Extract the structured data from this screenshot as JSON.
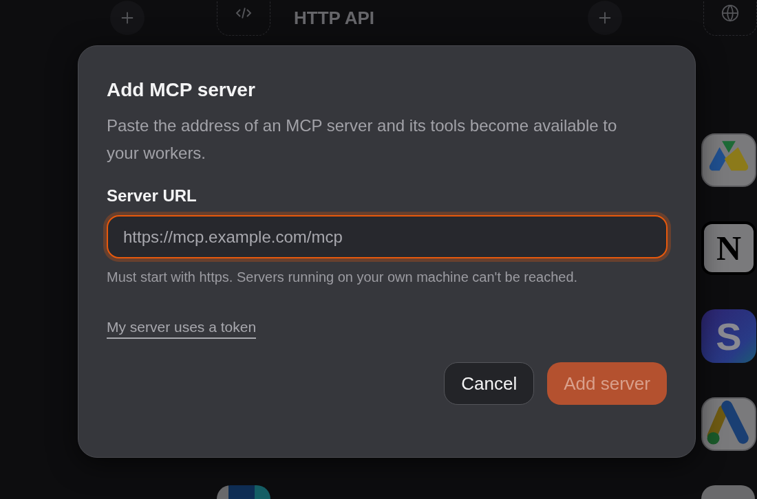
{
  "background": {
    "header": {
      "title": "HTTP API"
    },
    "apps": [
      {
        "kind": "triangle"
      },
      {
        "kind": "cube",
        "glyph": "N"
      },
      {
        "kind": "badge",
        "glyph": "S"
      },
      {
        "kind": "chevron"
      }
    ]
  },
  "dialog": {
    "title": "Add MCP server",
    "description": "Paste the address of an MCP server and its tools become available to your workers.",
    "field": {
      "label": "Server URL",
      "placeholder": "https://mcp.example.com/mcp",
      "focused": true
    },
    "help": "Must start with https. Servers running on your own machine can't be reached.",
    "token_link": "My server uses a token",
    "buttons": [
      {
        "label": "Cancel",
        "kind": "secondary",
        "disabled": false
      },
      {
        "label": "Add server",
        "kind": "primary",
        "disabled": true
      }
    ]
  }
}
